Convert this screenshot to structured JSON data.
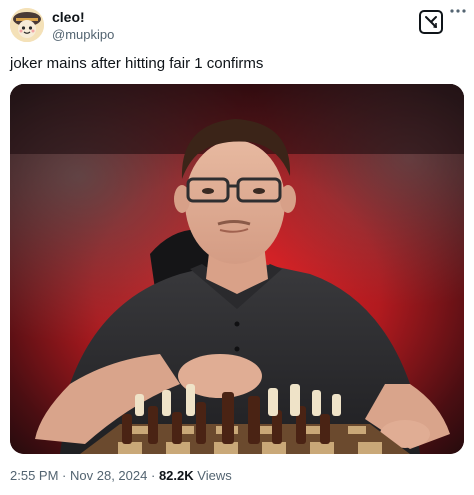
{
  "author": {
    "display_name": "cleo!",
    "handle": "@mupkipo",
    "avatar_icon": "avatar-icon"
  },
  "actions": {
    "grok_icon": "grok-icon",
    "more_icon": "more-options-icon"
  },
  "tweet": {
    "text": "joker mains after hitting fair 1 confirms"
  },
  "media": {
    "description_icon": "photo-image"
  },
  "meta": {
    "time": "2:55 PM",
    "separator_1": "·",
    "date": "Nov 28, 2024",
    "separator_2": "·",
    "views_count": "82.2K",
    "views_label": "Views"
  },
  "colors": {
    "text_primary": "#0f1419",
    "text_secondary": "#536471",
    "background": "#ffffff"
  }
}
